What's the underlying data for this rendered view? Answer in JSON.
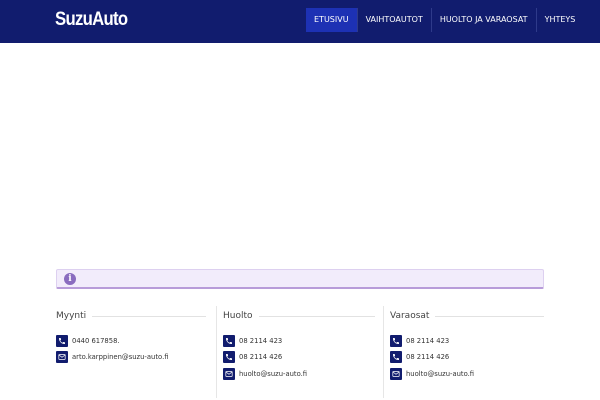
{
  "header": {
    "logo": "SuzuAuto",
    "nav": [
      {
        "label": "ETUSIVU",
        "active": true
      },
      {
        "label": "VAIHTOAUTOT",
        "active": false
      },
      {
        "label": "HUOLTO JA VARAOSAT",
        "active": false
      },
      {
        "label": "YHTEYS",
        "active": false
      }
    ]
  },
  "notice": {
    "icon": "info-icon"
  },
  "footer": {
    "columns": [
      {
        "title": "Myynti",
        "contacts": [
          {
            "icon": "phone-icon",
            "text": "0440 617858."
          },
          {
            "icon": "mail-icon",
            "text": "arto.karppinen@suzu-auto.fi"
          }
        ]
      },
      {
        "title": "Huolto",
        "contacts": [
          {
            "icon": "phone-icon",
            "text": "08 2114 423"
          },
          {
            "icon": "phone-icon",
            "text": "08 2114 426"
          },
          {
            "icon": "mail-icon",
            "text": "huolto@suzu-auto.fi"
          }
        ]
      },
      {
        "title": "Varaosat",
        "contacts": [
          {
            "icon": "phone-icon",
            "text": "08 2114 423"
          },
          {
            "icon": "phone-icon",
            "text": "08 2114 426"
          },
          {
            "icon": "mail-icon",
            "text": "huolto@suzu-auto.fi"
          }
        ]
      }
    ]
  },
  "colors": {
    "header_bg": "#111c6e",
    "nav_active": "#1d31b4",
    "notice_bg": "#f2ecfb",
    "notice_icon": "#8a6cbf"
  }
}
